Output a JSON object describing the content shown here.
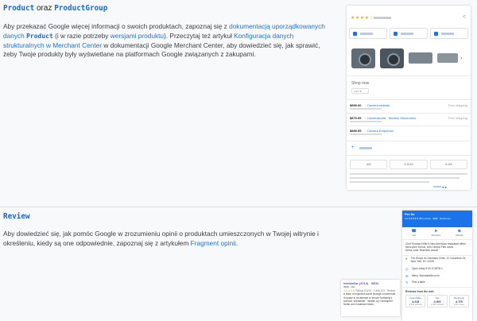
{
  "product_section": {
    "heading_code1": "Product",
    "heading_mid": " oraz ",
    "heading_code2": "ProductGroup",
    "p1": "Aby przekazać Google więcej informacji o swoich produktach, zapoznaj się z ",
    "link1": "dokumentacją uporządkowanych danych ",
    "link1_code": "Product",
    "p2": " (i w razie potrzeby ",
    "link2": "wersjami produktu",
    "p3": "). Przeczytaj też artykuł ",
    "link3": "Konfiguracja danych strukturalnych w Merchant Center",
    "p4": " w dokumentacji Google Merchant Center, aby dowiedzieć się, jak sprawić, żeby Twoje produkty były wyświetlane na platformach Google związanych z zakupami."
  },
  "shopping_panel": {
    "stars": "★★★★☆",
    "share_icon": "share-icon",
    "thumb_arrow": "›",
    "shop_now_label": "Shop now",
    "sort_label": "sort ▾",
    "sellers": [
      {
        "price": "$899.00",
        "name": "· Camera website",
        "right": "Free shipping"
      },
      {
        "price": "$879.95",
        "name": "· Cameraworld · Modern Electronics",
        "right": "Free shipping"
      },
      {
        "price": "$889.95",
        "name": "· Camera Emporium",
        "right": ""
      }
    ],
    "more_label": "+",
    "stats": [
      "4/5",
      "9.0/10",
      "4.0/5"
    ],
    "carousel_dots": "● ●"
  },
  "review_section": {
    "heading_code": "Review",
    "p1": "Aby dowiedzieć się, jak pomóc Google w zrozumieniu opinii o produktach umieszczonych w Twojej witrynie i określeniu, kiedy są one odpowiednie, zapoznaj się z artykułem ",
    "link": "Fragment opinii",
    "p2": "."
  },
  "knowledge_panel": {
    "title": "Per Se",
    "subtitle": "4.6 ★★★★★ 286 reviews · $$$$ · Restaurant",
    "actions": [
      {
        "icon": "☎",
        "label": "Call"
      },
      {
        "icon": "➤",
        "label": "Directions"
      },
      {
        "icon": "⊕",
        "label": "Website"
      }
    ],
    "description": "Chef Thomas Keller's New American restaurant offers fixed-price menus, with Central Park views.",
    "dress_line": "Dress code: Business casual",
    "lines": [
      {
        "icon": "⌖",
        "text": "The Shops at Columbus Circle, 10 Columbus Cir, New York, NY 10019"
      },
      {
        "icon": "◷",
        "text": "Open today 5:30–9:30PM ▾"
      },
      {
        "icon": "☰",
        "text": "Menu: thomaskeller.com"
      },
      {
        "icon": "✎",
        "text": "Find a table"
      }
    ],
    "reviews_title": "Reviews from the web",
    "scores": [
      {
        "source": "OpenTable",
        "value": "4.6/5",
        "count": "2,124 reviews"
      },
      {
        "source": "Yelp",
        "value": "4.5/5",
        "count": "1,542 reviews"
      },
      {
        "source": "Facebook",
        "value": "4.7/5",
        "count": "1,211 votes"
      }
    ]
  },
  "critic_card": {
    "title": "Interstellar (2014) · IMDb",
    "url": "IMDb › title",
    "rating_stars": "★★★★★",
    "rating_text": "Rating: 8.6/10 · 1,456,123 · Review",
    "body": "A team of explorers travel through a wormhole in space in an attempt to ensure humanity's survival. Interstellar · Written by Christopher Nolan and Jonathan Nolan."
  }
}
